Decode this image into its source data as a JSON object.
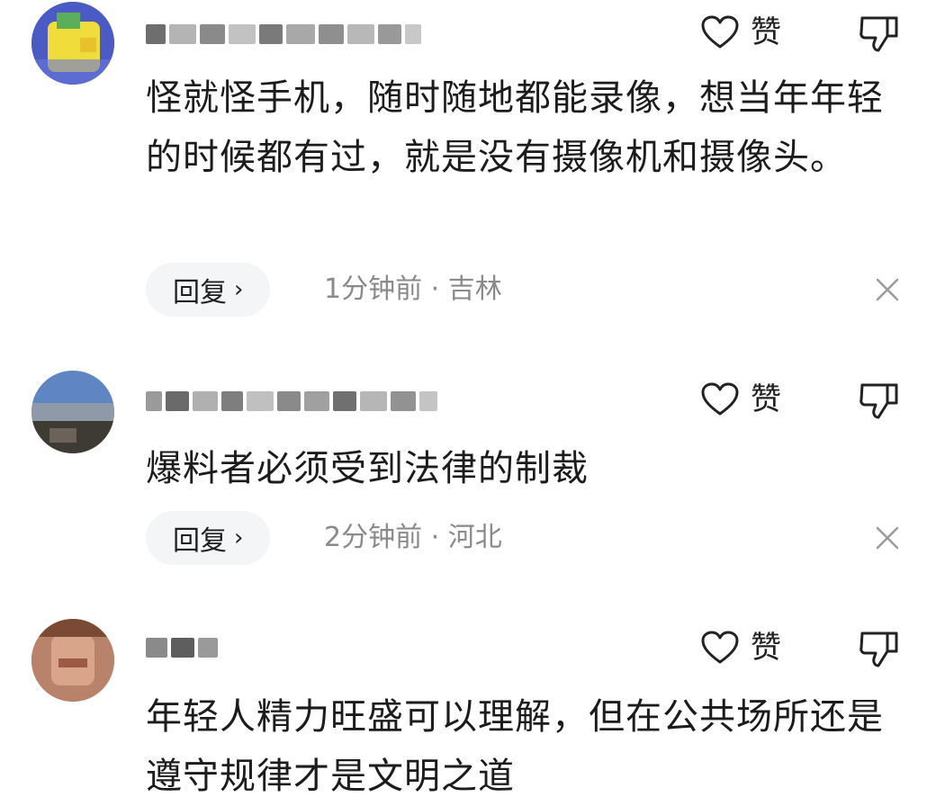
{
  "comments": [
    {
      "like_label": "赞",
      "text": "怪就怪手机，随时随地都能录像，想当年年轻的时候都有过，就是没有摄像机和摄像头。",
      "reply_label": "回复",
      "time": "1分钟前",
      "location": "吉林",
      "meta": "1分钟前 · 吉林"
    },
    {
      "like_label": "赞",
      "text": "爆料者必须受到法律的制裁",
      "reply_label": "回复",
      "time": "2分钟前",
      "location": "河北",
      "meta": "2分钟前 · 河北"
    },
    {
      "like_label": "赞",
      "text": "年轻人精力旺盛可以理解，但在公共场所还是遵守规律才是文明之道",
      "reply_label": "",
      "time": "",
      "location": "",
      "meta": ""
    }
  ],
  "icons": {
    "like": "heart-outline-icon",
    "dislike": "thumbs-down-outline-icon",
    "reply_chevron": "chevron-right-icon",
    "close": "close-icon"
  },
  "colors": {
    "text": "#1c1c1c",
    "meta": "#8a8a8a",
    "reply_bg": "#f4f5f7"
  }
}
